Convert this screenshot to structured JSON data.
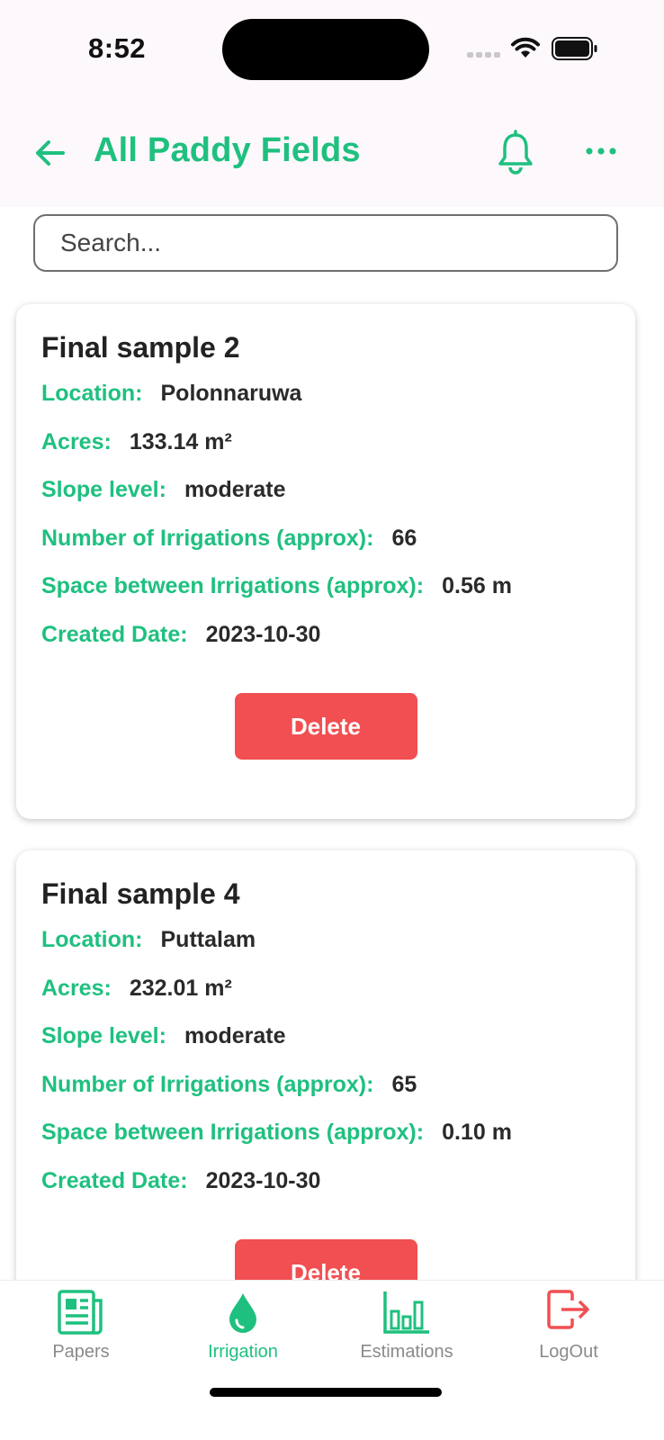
{
  "status_bar": {
    "time": "8:52"
  },
  "header": {
    "title": "All Paddy Fields"
  },
  "search": {
    "placeholder": "Search..."
  },
  "fields": [
    {
      "title": "Final sample 2",
      "location_label": "Location:",
      "location": "Polonnaruwa",
      "acres_label": "Acres:",
      "acres": "133.14 m²",
      "slope_label": "Slope level:",
      "slope": "moderate",
      "irrigations_label": "Number of Irrigations (approx):",
      "irrigations": "66",
      "space_label": "Space between Irrigations (approx):",
      "space": "0.56 m",
      "date_label": "Created Date:",
      "date": "2023-10-30",
      "delete_label": "Delete"
    },
    {
      "title": "Final sample 4",
      "location_label": "Location:",
      "location": "Puttalam",
      "acres_label": "Acres:",
      "acres": "232.01 m²",
      "slope_label": "Slope level:",
      "slope": "moderate",
      "irrigations_label": "Number of Irrigations (approx):",
      "irrigations": "65",
      "space_label": "Space between Irrigations (approx):",
      "space": "0.10 m",
      "date_label": "Created Date:",
      "date": "2023-10-30",
      "delete_label": "Delete"
    }
  ],
  "nav": {
    "items": [
      {
        "label": "Papers",
        "icon": "newspaper-icon"
      },
      {
        "label": "Irrigation",
        "icon": "water-drop-icon",
        "active": true
      },
      {
        "label": "Estimations",
        "icon": "bar-chart-icon"
      },
      {
        "label": "LogOut",
        "icon": "logout-icon"
      }
    ]
  },
  "colors": {
    "accent": "#1fc07f",
    "danger": "#f14f52",
    "header_bg": "#fdf8fc"
  }
}
